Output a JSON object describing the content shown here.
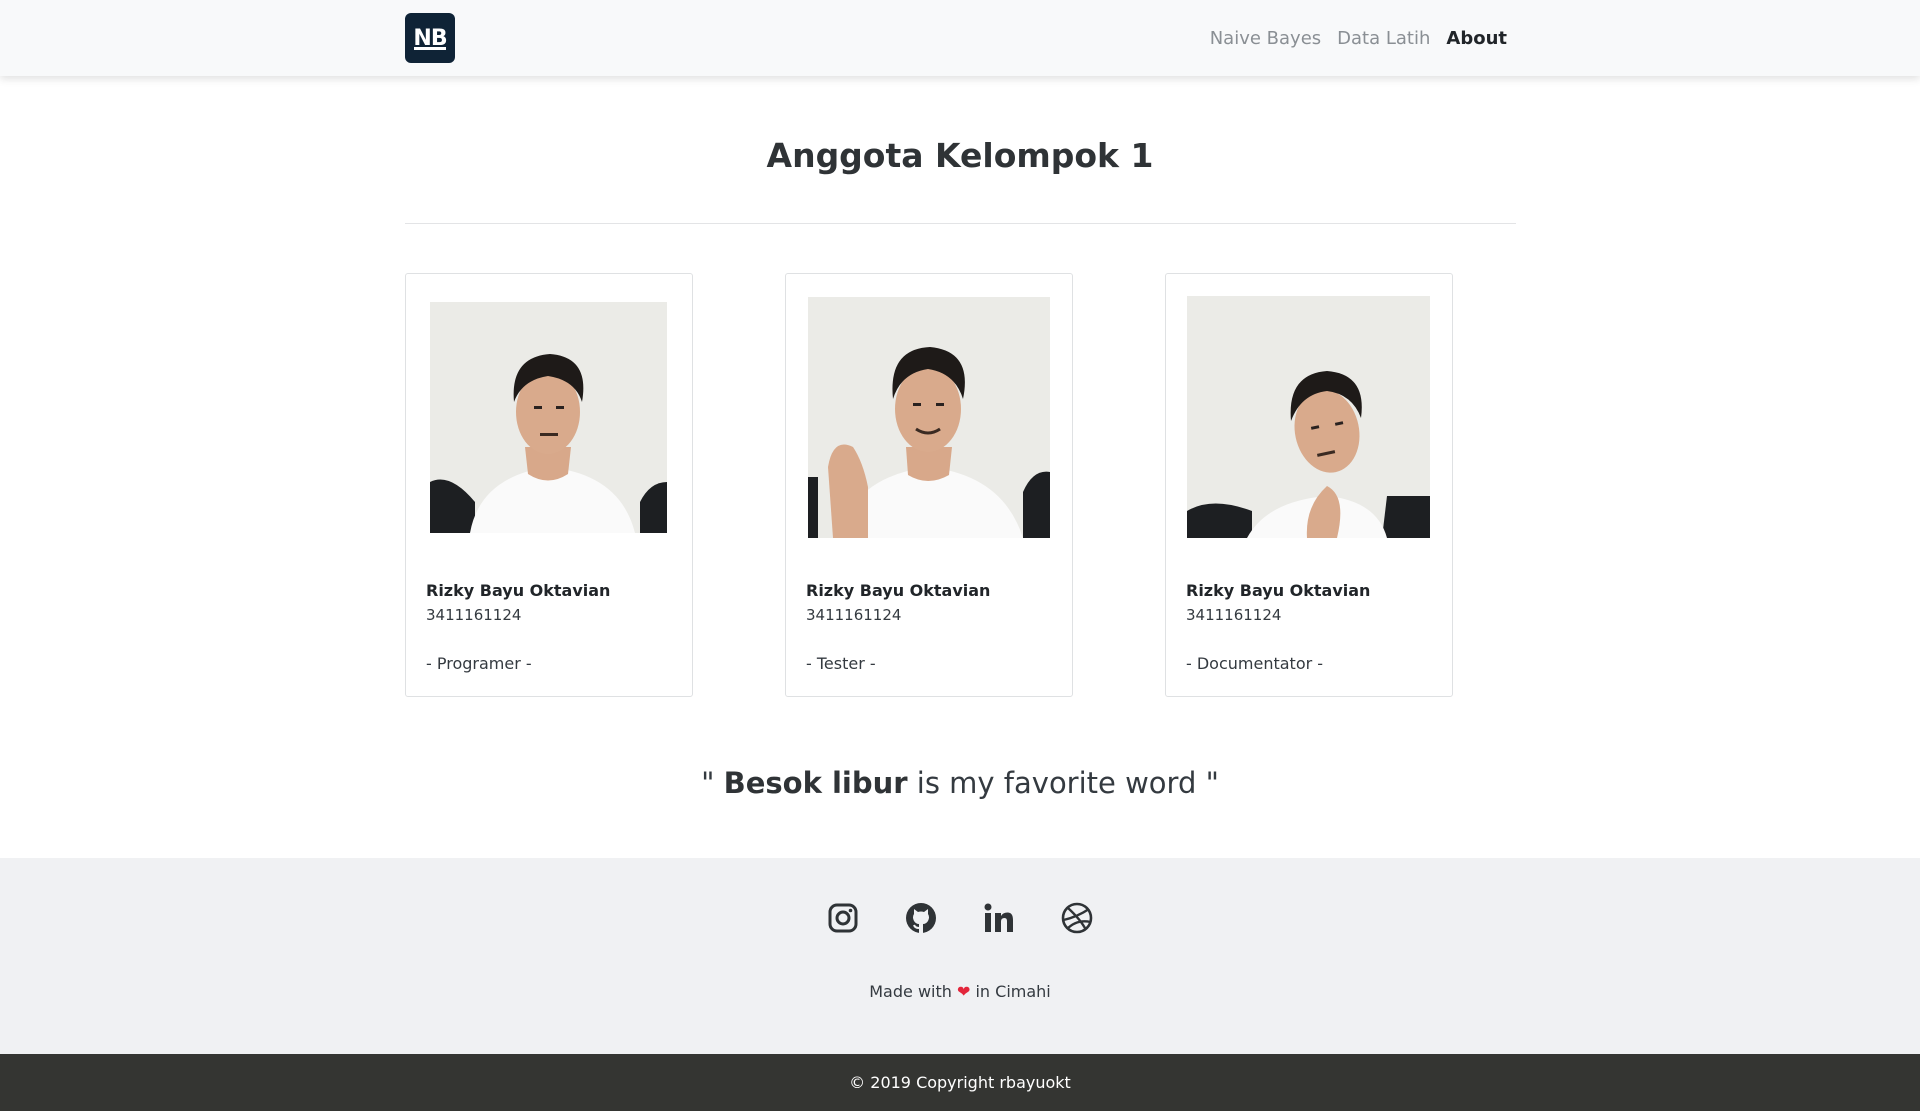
{
  "navbar": {
    "brand": "NB",
    "items": [
      {
        "label": "Naive Bayes",
        "active": false
      },
      {
        "label": "Data Latih",
        "active": false
      },
      {
        "label": "About",
        "active": true
      }
    ]
  },
  "page": {
    "title": "Anggota Kelompok 1"
  },
  "members": [
    {
      "name": "Rizky Bayu Oktavian",
      "nim": "3411161124",
      "role": "- Programer -"
    },
    {
      "name": "Rizky Bayu Oktavian",
      "nim": "3411161124",
      "role": "- Tester -"
    },
    {
      "name": "Rizky Bayu Oktavian",
      "nim": "3411161124",
      "role": "- Documentator -"
    }
  ],
  "quote": {
    "open": "\" ",
    "bold": "Besok libur",
    "rest": " is my favorite word \""
  },
  "footer": {
    "socials": [
      {
        "icon": "instagram-icon"
      },
      {
        "icon": "github-icon"
      },
      {
        "icon": "linkedin-icon"
      },
      {
        "icon": "dribbble-icon"
      }
    ],
    "made_prefix": "Made with",
    "made_suffix": "in Cimahi",
    "heart_color": "#e3263b",
    "copyright": "© 2019 Copyright rbayuokt"
  },
  "colors": {
    "brand_bg": "#0f2336",
    "copyright_bg": "#343532",
    "footer_bg": "#f0f1f3"
  }
}
